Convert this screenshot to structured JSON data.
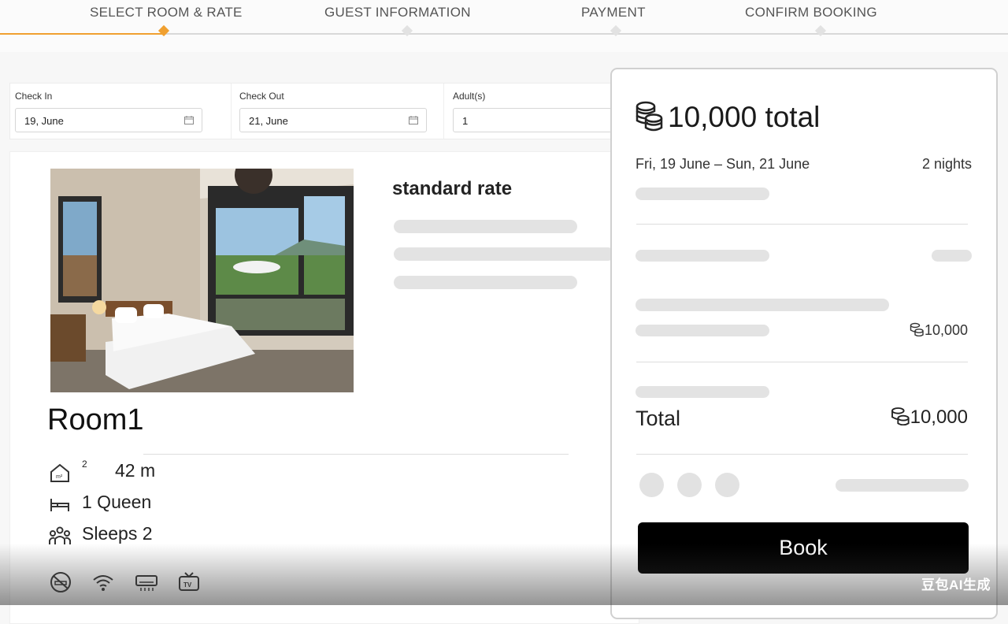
{
  "steps": [
    {
      "label": "SELECT ROOM & RATE",
      "active": true
    },
    {
      "label": "GUEST INFORMATION",
      "active": false
    },
    {
      "label": "PAYMENT",
      "active": false
    },
    {
      "label": "CONFIRM BOOKING",
      "active": false
    }
  ],
  "form": {
    "check_in": {
      "label": "Check In",
      "value": "19, June"
    },
    "check_out": {
      "label": "Check Out",
      "value": "21, June"
    },
    "adults": {
      "label": "Adult(s)",
      "value": "1"
    }
  },
  "room": {
    "title": "Room1",
    "rate_name": "standard rate",
    "features": {
      "area": "42 m",
      "area_unit_sup": "2",
      "bed": "1  Queen",
      "sleeps": "Sleeps 2"
    },
    "amenity_icons": [
      "no-smoking-icon",
      "wifi-icon",
      "air-conditioner-icon",
      "tv-icon"
    ]
  },
  "summary": {
    "total_heading": "10,000 total",
    "dates": "Fri, 19 June – Sun, 21 June",
    "nights": "2 nights",
    "line_amount": "10,000",
    "total_label": "Total",
    "total_amount": "10,000",
    "book_label": "Book",
    "currency_icon": "coin-stack-icon"
  },
  "watermark": "豆包AI生成",
  "colors": {
    "accent": "#f0a030",
    "button": "#000000",
    "skeleton": "#e3e3e3"
  }
}
